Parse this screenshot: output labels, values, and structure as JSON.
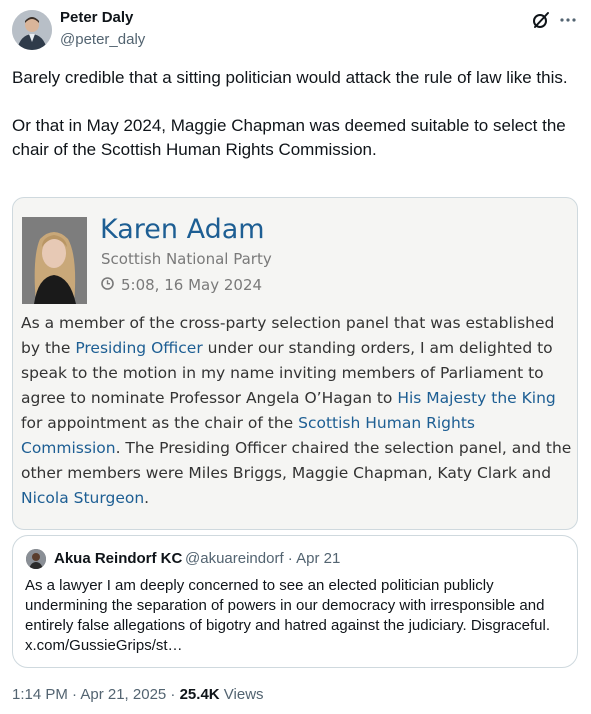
{
  "author": {
    "name": "Peter Daly",
    "handle": "@peter_daly"
  },
  "tweet": {
    "paragraph1": "Barely credible that a sitting politician would attack the rule of law like this.",
    "paragraph2": "Or that in May 2024, Maggie Chapman was deemed suitable to select the chair of the Scottish Human Rights Commission."
  },
  "embedded": {
    "speaker": "Karen Adam",
    "party": "Scottish National Party",
    "timestamp": "5:08, 16 May 2024",
    "body": [
      "As a member of the cross-party selection panel that was established by the ",
      "Presiding Officer",
      " under our standing orders, I am delighted to speak to the motion in my name inviting members of Parliament to agree to nominate Professor Angela O’Hagan to ",
      "His Majesty the King",
      " for appointment as the chair of the ",
      "Scottish Human Rights Commission",
      ". The Presiding Officer chaired the selection panel, and the other members were Miles Briggs, Maggie Chapman, Katy Clark and ",
      "Nicola Sturgeon",
      "."
    ]
  },
  "quoted": {
    "name": "Akua Reindorf KC",
    "meta": "@akuareindorf · Apr 21",
    "text": "As a lawyer I am deeply concerned to see an elected politician publicly undermining the separation of powers in our democracy with irresponsible and entirely false allegations of bigotry and hatred against the judiciary. Disgraceful. x.com/GussieGrips/st…"
  },
  "footer": {
    "time": "1:14 PM · Apr 21, 2025 · ",
    "views_count": "25.4K",
    "views_label": " Views"
  },
  "icons": {
    "grok": "grok-slash-circle-icon",
    "more": "more-horizontal-icon",
    "clock": "clock-icon"
  },
  "colors": {
    "primary_text": "#0f1419",
    "secondary_text": "#536471",
    "card_link": "#1d5e93",
    "card_background": "#f5f5f3",
    "border": "#cfd9de"
  }
}
